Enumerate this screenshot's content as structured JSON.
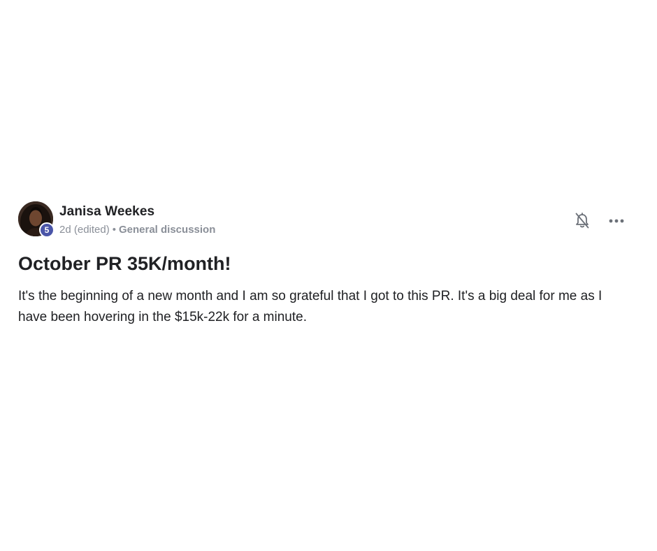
{
  "post": {
    "author": {
      "name": "Janisa Weekes",
      "level": "5"
    },
    "meta": {
      "time": "2d",
      "edited": "(edited)",
      "separator": "•",
      "category": "General discussion"
    },
    "title": "October PR 35K/month!",
    "body": "It's the beginning of a new month and I am so grateful that I got to this PR. It's a big deal for me as I have been hovering in the $15k-22k for a minute.",
    "actions": {
      "notifications_icon": "bell-off-icon",
      "more_icon": "more-horizontal-icon"
    }
  },
  "colors": {
    "badge": "#4a55a8",
    "text": "#202124",
    "meta": "#8a8f98",
    "icon": "#6b7078"
  }
}
